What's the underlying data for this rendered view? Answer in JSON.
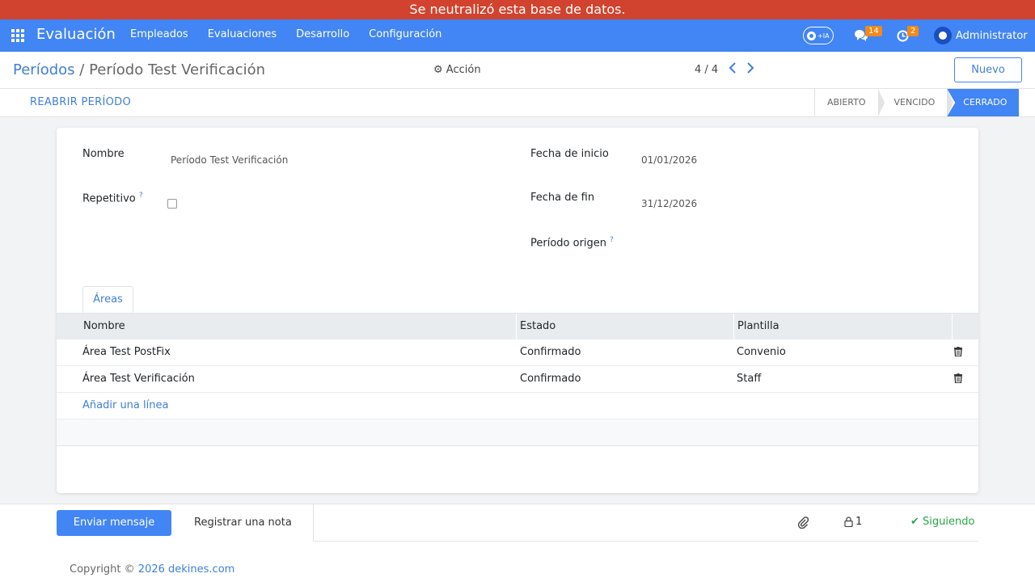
{
  "banner": {
    "text": "Se neutralizó esta base de datos."
  },
  "navbar": {
    "brand": "Evaluación",
    "menu": [
      "Empleados",
      "Evaluaciones",
      "Desarrollo",
      "Configuración"
    ],
    "ia_label": "IA",
    "messages_count": "14",
    "activities_count": "2",
    "user": "Administrator"
  },
  "controlpanel": {
    "breadcrumb_parent": "Períodos",
    "breadcrumb_separator": "/",
    "breadcrumb_current": "Período Test Verificación",
    "action_label": "Acción",
    "pager": "4 / 4",
    "new_label": "Nuevo"
  },
  "statusbar": {
    "reopen_label": "REABRIR PERÍODO",
    "stages": [
      "ABIERTO",
      "VENCIDO",
      "CERRADO"
    ],
    "active_stage": "CERRADO"
  },
  "form": {
    "nombre_label": "Nombre",
    "nombre_value": "Período Test Verificación",
    "repetitivo_label": "Repetitivo",
    "repetitivo_checked": false,
    "help_mark": "?",
    "fecha_inicio_label": "Fecha de inicio",
    "fecha_inicio_value": "01/01/2026",
    "fecha_fin_label": "Fecha de fin",
    "fecha_fin_value": "31/12/2026",
    "periodo_origen_label": "Período origen"
  },
  "areas": {
    "tab_label": "Áreas",
    "columns": [
      "Nombre",
      "Estado",
      "Plantilla"
    ],
    "rows": [
      {
        "nombre": "Área Test PostFix",
        "estado": "Confirmado",
        "plantilla": "Convenio"
      },
      {
        "nombre": "Área Test Verificación",
        "estado": "Confirmado",
        "plantilla": "Staff"
      }
    ],
    "add_line": "Añadir una línea"
  },
  "chatter": {
    "send_message": "Enviar mensaje",
    "log_note": "Registrar una nota",
    "followers_count": "1",
    "following_label": "Siguiendo"
  },
  "footer": {
    "copyright_prefix": "Copyright ©",
    "copyright_link": "2026 dekines.com"
  },
  "colors": {
    "navbar": "#4285f4",
    "banner": "#d1432e",
    "badge": "#f1891b",
    "link": "#3f7fd6",
    "following": "#28a745"
  }
}
